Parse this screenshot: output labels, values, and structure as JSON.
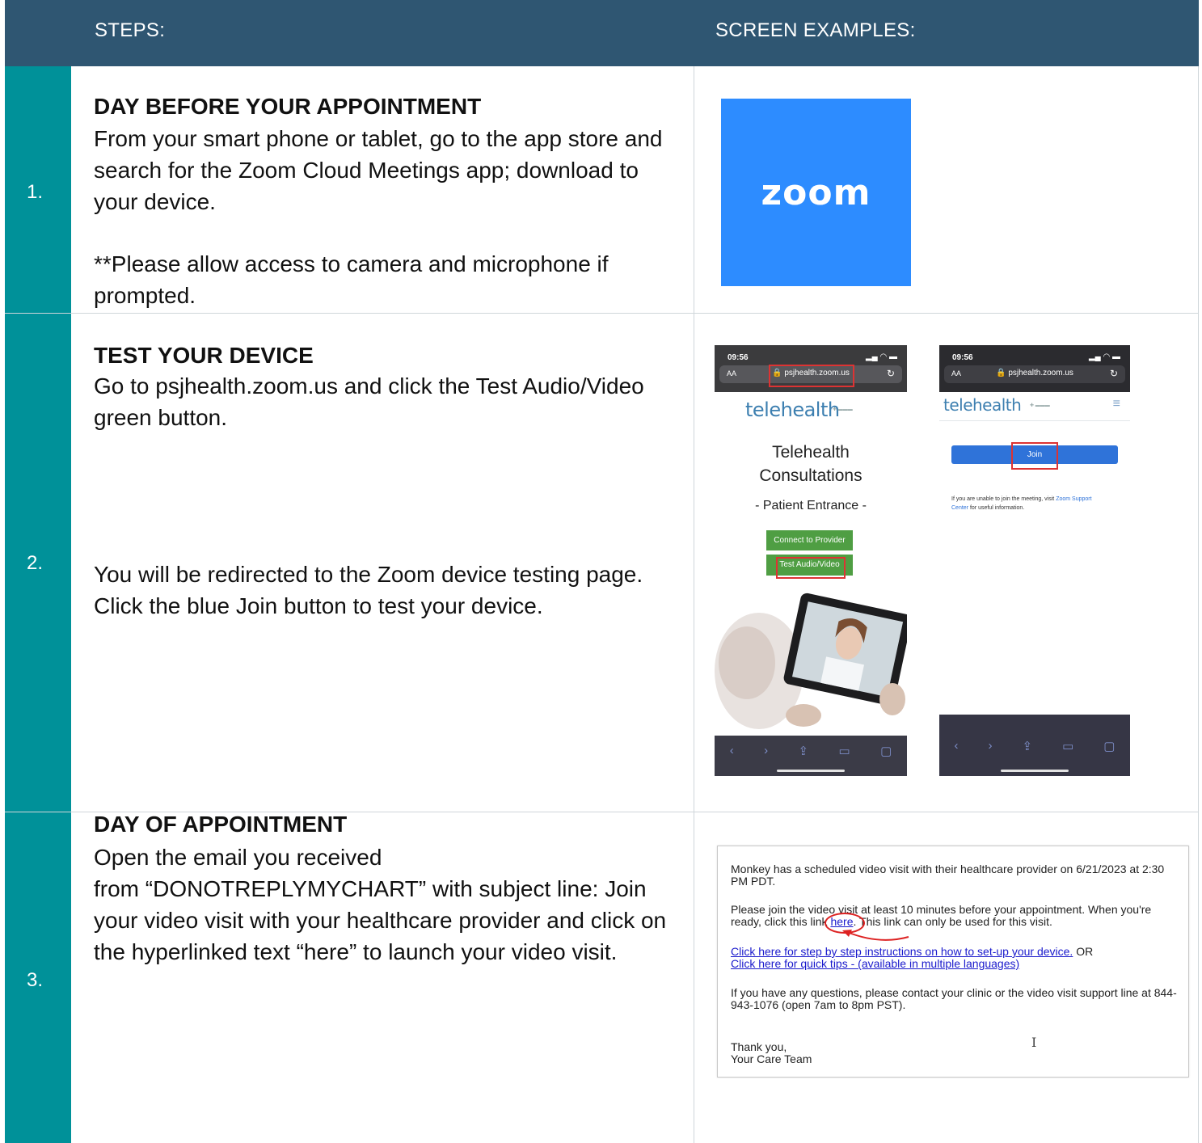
{
  "header": {
    "steps_label": "STEPS:",
    "examples_label": "SCREEN EXAMPLES:"
  },
  "steps": [
    {
      "number": "1.",
      "title": "DAY BEFORE YOUR APPOINTMENT",
      "lines": [
        "From your smart phone or tablet, go to the app store and",
        "search for the Zoom Cloud Meetings app; download to",
        "your device."
      ],
      "note_lines": [
        "**Please allow access to camera and microphone if",
        "prompted."
      ]
    },
    {
      "number": "2.",
      "title": "TEST YOUR DEVICE",
      "lines": [
        "Go to psjhealth.zoom.us and click the Test Audio/Video",
        "green button."
      ],
      "lines2": [
        "You will be redirected to the Zoom device testing page.",
        "Click the blue Join button to test your device."
      ]
    },
    {
      "number": "3.",
      "title": "DAY OF APPOINTMENT",
      "lines": [
        "Open the email you received",
        "from “DONOTREPLYMYCHART” with subject line: Join",
        "your video visit with your healthcare provider and click on",
        "the hyperlinked text “here” to launch your video visit."
      ]
    }
  ],
  "zoom_logo_text": "zoom",
  "phone1": {
    "time": "09:56",
    "url": "psjhealth.zoom.us",
    "aa": "AA",
    "logo": "telehealth",
    "heading_line1": "Telehealth",
    "heading_line2": "Consultations",
    "sub": "- Patient Entrance -",
    "btn_connect": "Connect to Provider",
    "btn_test": "Test Audio/Video"
  },
  "phone2": {
    "time": "09:56",
    "url": "psjhealth.zoom.us",
    "aa": "AA",
    "logo": "telehealth",
    "join": "Join",
    "help_prefix": "If you are unable to join the meeting, visit ",
    "help_link": "Zoom Support",
    "help_link2": "Center",
    "help_suffix": " for useful information."
  },
  "email": {
    "p1": "Monkey has a scheduled video visit with their healthcare provider on 6/21/2023 at 2:30 PM PDT.",
    "p2_a": "Please join the video visit at least 10 minutes before your appointment. When you're ready, click this link ",
    "p2_link": "here",
    "p2_b": ". This link can only be used for this visit.",
    "link1": "Click here for step by step instructions on how to set-up your device.",
    "link1_suffix": " OR",
    "link2": "Click here for quick tips - (available in multiple languages)",
    "p4": "If you have any questions, please contact your clinic or the video visit support line at 844-943-1076 (open 7am to 8pm PST).",
    "thanks": "Thank you,",
    "team": "Your Care Team",
    "cursor": "I"
  }
}
